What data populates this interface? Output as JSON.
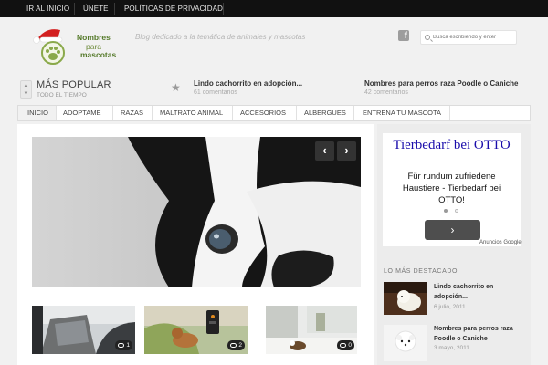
{
  "topbar": {
    "items": [
      "IR AL INICIO",
      "ÚNETE",
      "POLÍTICAS DE PRIVACIDAD"
    ]
  },
  "header": {
    "logo_text": [
      "Nombres",
      "para",
      "mascotas"
    ],
    "tagline": "Blog dedicado a la temática de animales y mascotas",
    "search_placeholder": "Busca escribiendo y enter",
    "facebook_icon": "facebook-icon"
  },
  "popular": {
    "title": "MÁS POPULAR",
    "subtitle": "TODO EL TIEMPO",
    "items": [
      {
        "title": "Lindo cachorrito en adopción...",
        "meta": "61 comentarios"
      },
      {
        "title": "Nombres para perros raza Poodle o Caniche",
        "meta": "42 comentarios"
      }
    ]
  },
  "nav": {
    "items": [
      "INICIO",
      "ADOPTAME",
      "RAZAS",
      "MALTRATO ANIMAL",
      "ACCESORIOS",
      "ALBERGUES",
      "ENTRENA TU MASCOTA"
    ],
    "active_index": 0
  },
  "slider": {
    "prev_label": "‹",
    "next_label": "›"
  },
  "thumbs": [
    {
      "comments": "1"
    },
    {
      "comments": "2"
    },
    {
      "comments": "0"
    }
  ],
  "ad": {
    "headline": "Tierbedarf bei OTTO",
    "body": "Für rundum zufriedene Haustiere - Tierbedarf bei OTTO!",
    "button_label": "›",
    "footer": "Anuncios Google"
  },
  "sidebar": {
    "heading": "LO MÁS DESTACADO",
    "items": [
      {
        "title": "Lindo cachorrito en adopción...",
        "date": "6 julio, 2011"
      },
      {
        "title": "Nombres para perros raza Poodle o Caniche",
        "date": "3 mayo, 2011"
      }
    ]
  },
  "colors": {
    "topbar": "#111111",
    "accent_green": "#557a2a",
    "ad_link": "#1a0dab"
  }
}
